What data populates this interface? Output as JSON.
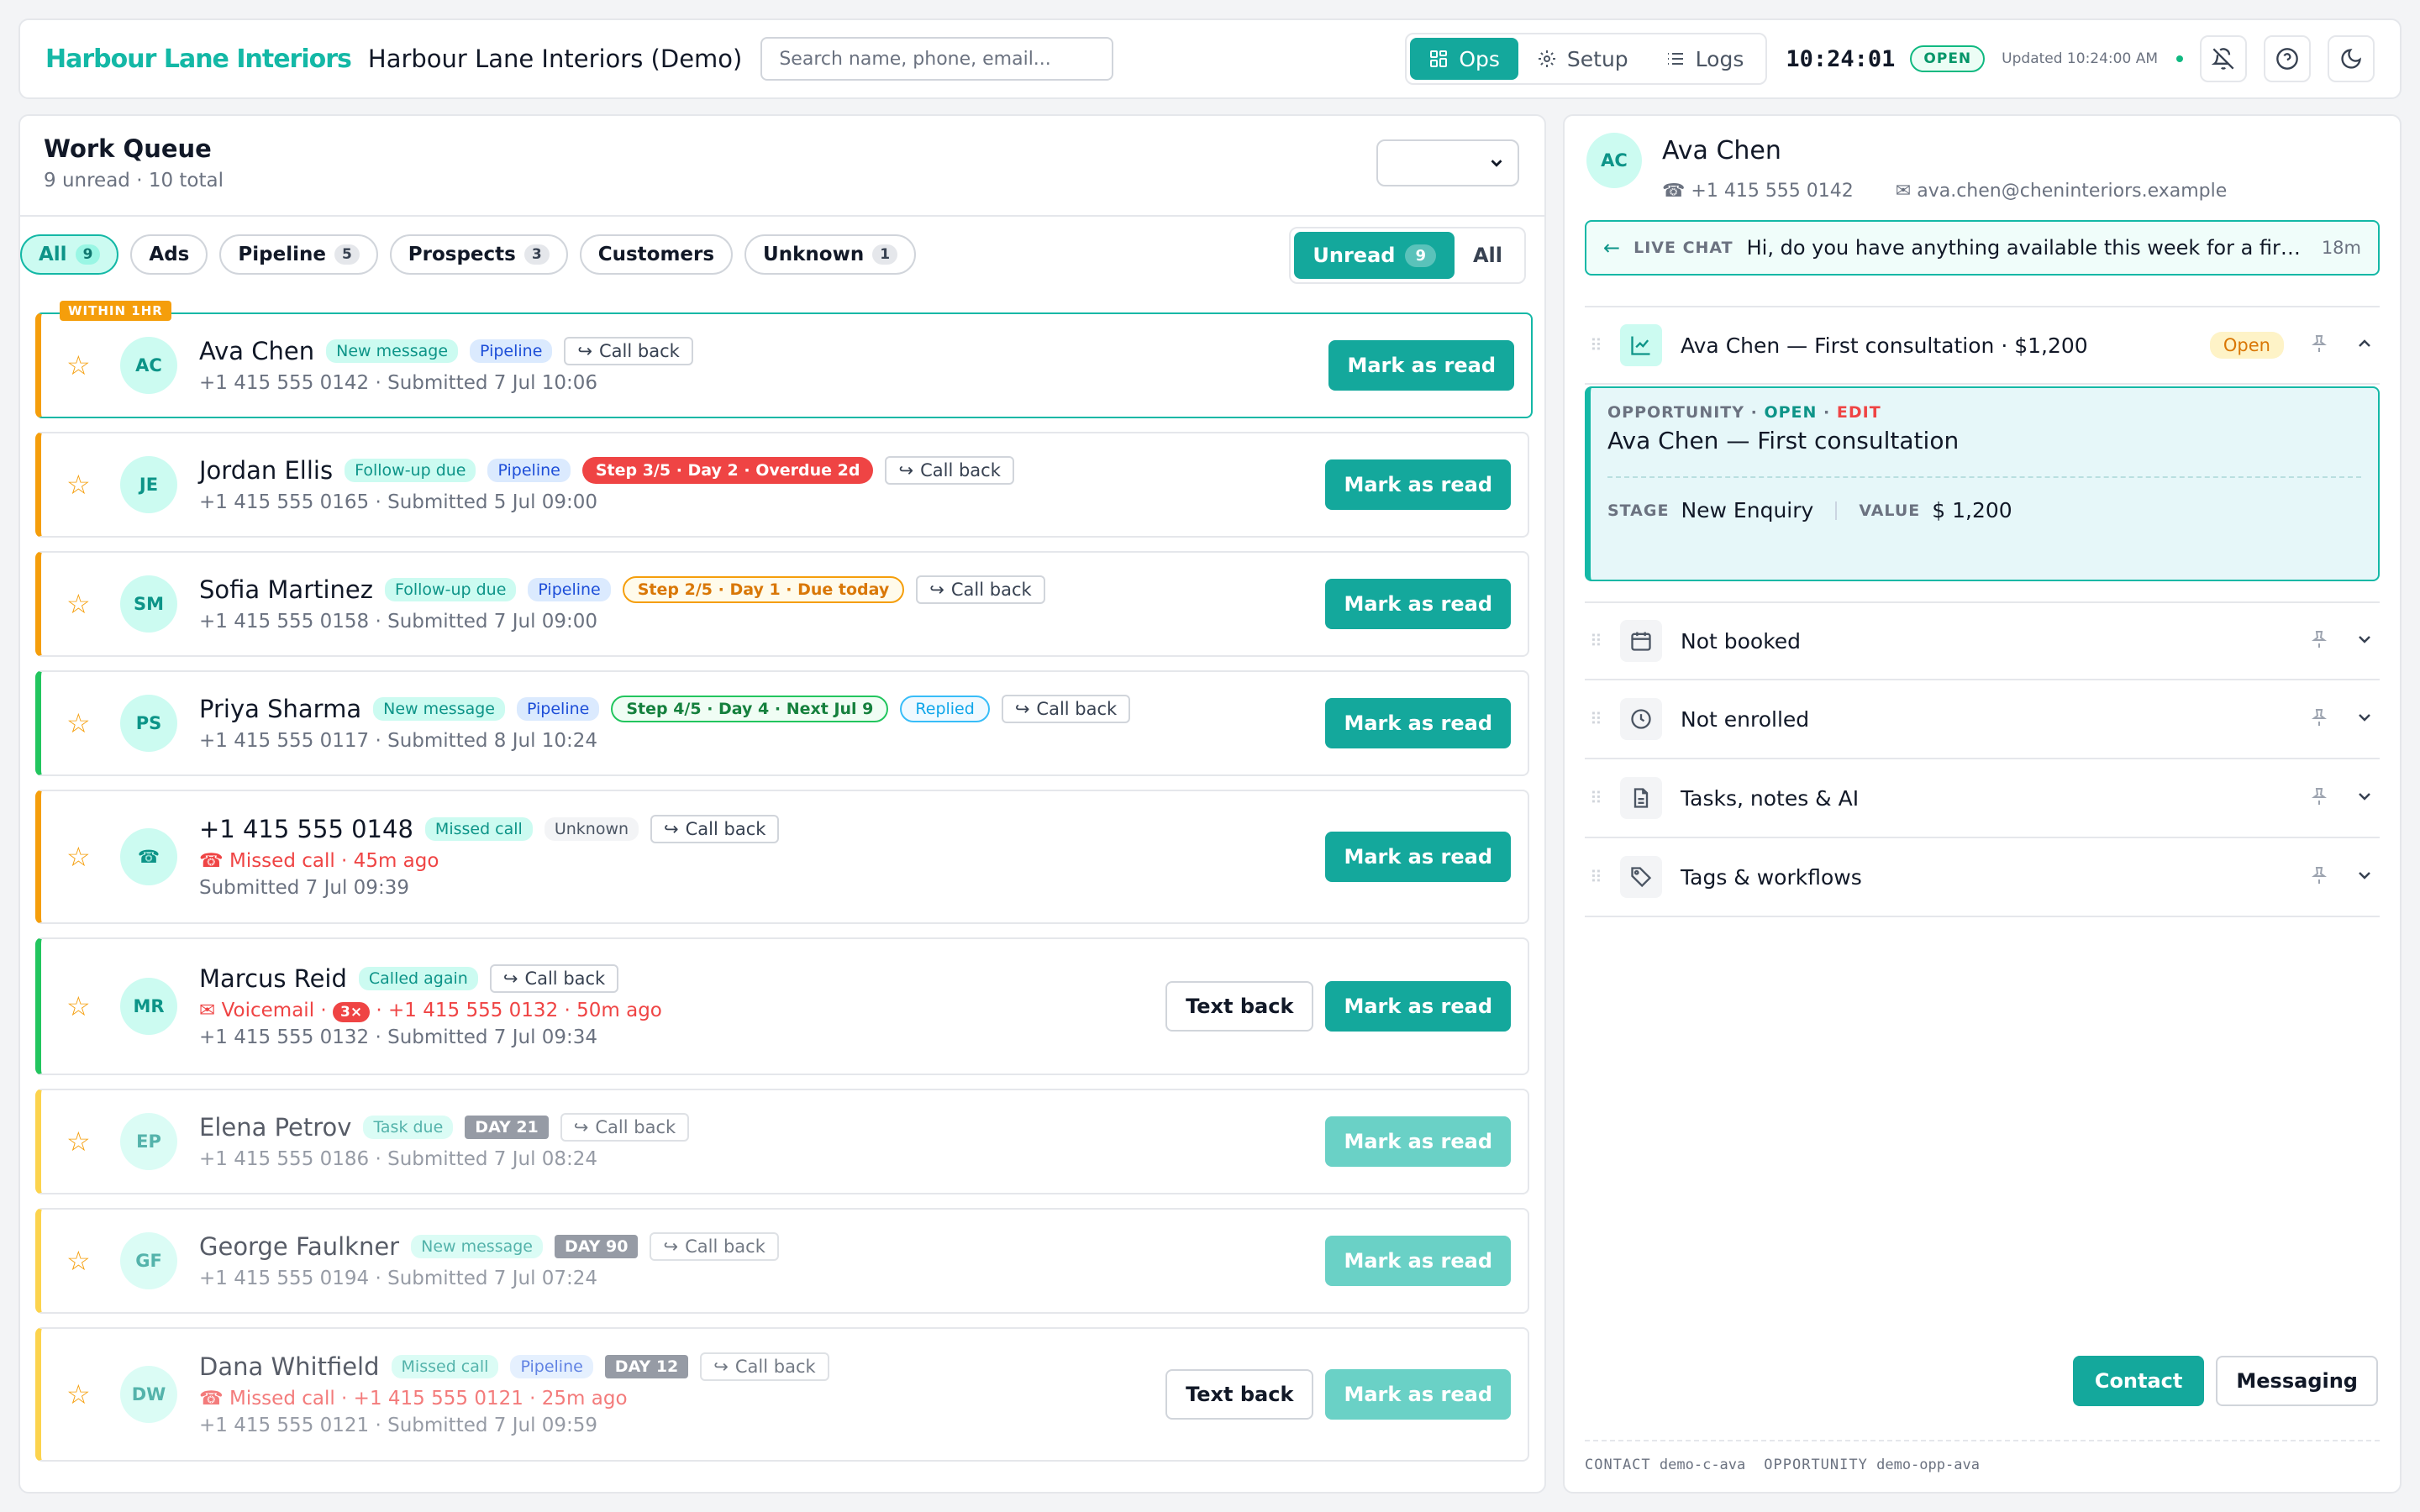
{
  "header": {
    "brand": "Harbour Lane Interiors",
    "org_name": "Harbour Lane Interiors (Demo)",
    "search_placeholder": "Search name, phone, email...",
    "nav": [
      {
        "label": "Ops",
        "icon": "grid-icon",
        "active": true
      },
      {
        "label": "Setup",
        "icon": "gear-icon",
        "active": false
      },
      {
        "label": "Logs",
        "icon": "list-icon",
        "active": false
      }
    ],
    "clock": "10:24:01",
    "status": "OPEN",
    "updated": "Updated 10:24:00 AM"
  },
  "queue": {
    "title": "Work Queue",
    "subtitle": "9 unread · 10 total",
    "filters": [
      {
        "label": "All",
        "count": "9",
        "active": true
      },
      {
        "label": "Ads",
        "count": ""
      },
      {
        "label": "Pipeline",
        "count": "5"
      },
      {
        "label": "Prospects",
        "count": "3"
      },
      {
        "label": "Customers",
        "count": ""
      },
      {
        "label": "Unknown",
        "count": "1"
      }
    ],
    "toggle": {
      "unread_label": "Unread",
      "unread_count": "9",
      "all_label": "All"
    },
    "ribbon": "WITHIN 1HR",
    "mark_label": "Mark as read",
    "textback_label": "Text back",
    "callback_label": "Call back",
    "rows": [
      {
        "initials": "AC",
        "name": "Ava Chen",
        "tag1": "New message",
        "tag2": "Pipeline",
        "meta": "+1 415 555 0142 · Submitted 7 Jul 10:06"
      },
      {
        "initials": "JE",
        "name": "Jordan Ellis",
        "tag1": "Follow-up due",
        "tag2": "Pipeline",
        "step": "Step 3/5 · Day 2 · Overdue 2d",
        "meta": "+1 415 555 0165 · Submitted 5 Jul 09:00"
      },
      {
        "initials": "SM",
        "name": "Sofia Martinez",
        "tag1": "Follow-up due",
        "tag2": "Pipeline",
        "step": "Step 2/5 · Day 1 · Due today",
        "meta": "+1 415 555 0158 · Submitted 7 Jul 09:00"
      },
      {
        "initials": "PS",
        "name": "Priya Sharma",
        "tag1": "New message",
        "tag2": "Pipeline",
        "step": "Step 4/5 · Day 4 · Next Jul 9",
        "replied": "Replied",
        "meta": "+1 415 555 0117 · Submitted 8 Jul 10:24"
      },
      {
        "name": "+1 415 555 0148",
        "tag1": "Missed call",
        "tag2": "Unknown",
        "alert": "Missed call · 45m ago",
        "meta": "Submitted 7 Jul 09:39"
      },
      {
        "initials": "MR",
        "name": "Marcus Reid",
        "tag1": "Called again",
        "alert_prefix": "Voicemail ·",
        "alert_badge": "3×",
        "alert": "· +1 415 555 0132 · 50m ago",
        "meta": "+1 415 555 0132 · Submitted 7 Jul 09:34"
      },
      {
        "initials": "EP",
        "name": "Elena Petrov",
        "tag1": "Task due",
        "day": "DAY 21",
        "meta": "+1 415 555 0186 · Submitted 7 Jul 08:24"
      },
      {
        "initials": "GF",
        "name": "George Faulkner",
        "tag1": "New message",
        "day": "DAY 90",
        "meta": "+1 415 555 0194 · Submitted 7 Jul 07:24"
      },
      {
        "initials": "DW",
        "name": "Dana Whitfield",
        "tag1": "Missed call",
        "tag2": "Pipeline",
        "day": "DAY 12",
        "alert": "Missed call · +1 415 555 0121 · 25m ago",
        "meta": "+1 415 555 0121 · Submitted 7 Jul 09:59"
      }
    ]
  },
  "detail": {
    "initials": "AC",
    "name": "Ava Chen",
    "phone": "+1 415 555 0142",
    "email": "ava.chen@cheninteriors.example",
    "chat_label": "LIVE CHAT",
    "chat_message": "Hi, do you have anything available this week for a first consultation?",
    "chat_time": "18m",
    "opportunity_section": "Ava Chen — First consultation · $1,200",
    "opportunity_status": "Open",
    "opp_label": "OPPORTUNITY",
    "opp_state": "OPEN",
    "opp_edit": "EDIT",
    "opp_title": "Ava Chen — First consultation",
    "stage_label": "STAGE",
    "stage": "New Enquiry",
    "value_label": "VALUE",
    "value": "$ 1,200",
    "sections": [
      "Not booked",
      "Not enrolled",
      "Tasks, notes & AI",
      "Tags & workflows"
    ],
    "contact_btn": "Contact",
    "messaging_btn": "Messaging",
    "foot_contact_label": "CONTACT",
    "foot_contact_id": "demo-c-ava",
    "foot_opp_label": "OPPORTUNITY",
    "foot_opp_id": "demo-opp-ava"
  }
}
